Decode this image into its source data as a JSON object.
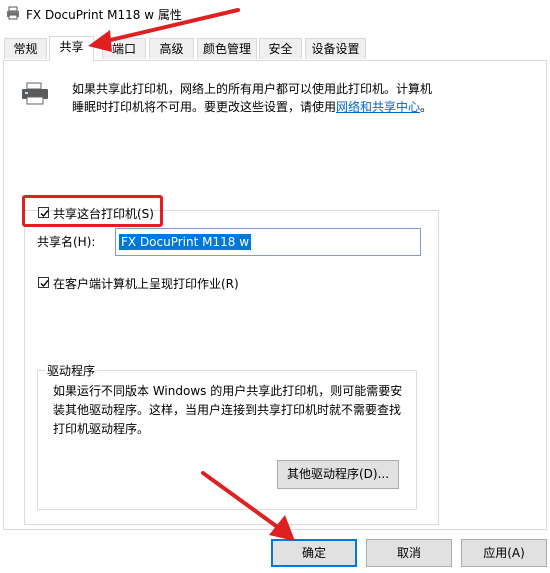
{
  "window": {
    "title": "FX DocuPrint M118 w 属性"
  },
  "tabs": [
    {
      "label": "常规"
    },
    {
      "label": "共享"
    },
    {
      "label": "端口"
    },
    {
      "label": "高级"
    },
    {
      "label": "颜色管理"
    },
    {
      "label": "安全"
    },
    {
      "label": "设备设置"
    }
  ],
  "sharing": {
    "info_line1": "如果共享此打印机，网络上的所有用户都可以使用此打印机。计算机",
    "info_line2_prefix": "睡眠时打印机将不可用。要更改这些设置，请使用",
    "info_link": "网络和共享中心",
    "info_suffix": "。",
    "share_checkbox_label": "共享这台打印机(S)",
    "share_checked": true,
    "share_name_label": "共享名(H):",
    "share_name_value": "FX DocuPrint M118 w",
    "render_checkbox_label": "在客户端计算机上呈现打印作业(R)",
    "render_checked": true
  },
  "drivers": {
    "legend": "驱动程序",
    "description": "如果运行不同版本 Windows 的用户共享此打印机，则可能需要安装其他驱动程序。这样，当用户连接到共享打印机时就不需要查找打印机驱动程序。",
    "other_drivers_button": "其他驱动程序(D)..."
  },
  "footer": {
    "ok": "确定",
    "cancel": "取消",
    "apply": "应用(A)"
  },
  "colors": {
    "annotation_red": "#e02020",
    "selection_blue": "#0078d7",
    "link_blue": "#0066cc"
  }
}
